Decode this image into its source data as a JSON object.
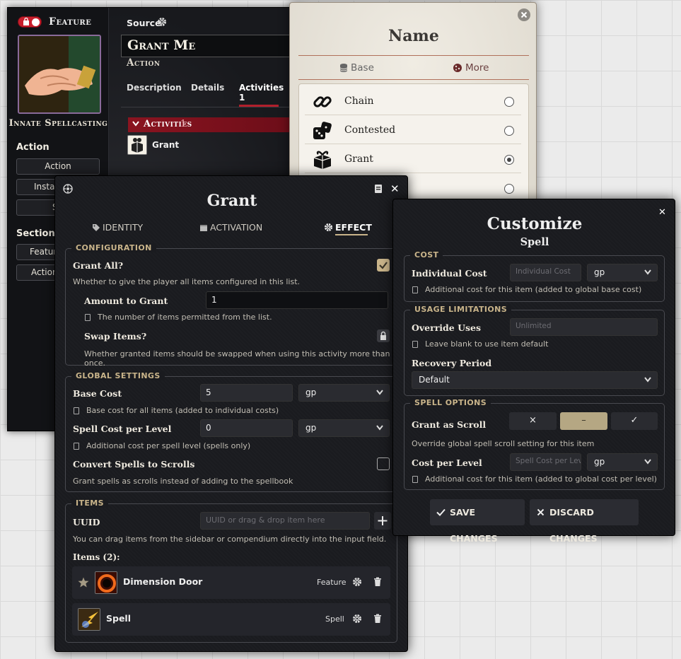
{
  "item_sheet": {
    "type_label": "Feature",
    "portrait_caption": "Innate Spellcasting",
    "activation_heading": "Action",
    "buttons": [
      "Action",
      "Instan",
      "S"
    ],
    "sections_heading": "Sections",
    "section_buttons": [
      "Feature",
      "Actions"
    ],
    "source_label": "Source",
    "item_name": "Grant Me",
    "subtitle": "Action",
    "tabs": [
      "Description",
      "Details",
      "Activities"
    ],
    "activities_tab_count": "1",
    "activities_header": "Activities",
    "activities_header_count": "1",
    "activities": [
      {
        "name": "Grant"
      }
    ]
  },
  "choice_dialog": {
    "title": "Name",
    "tabs": {
      "base": "Base",
      "more": "More"
    },
    "options": [
      {
        "label": "Chain",
        "icon": "chain-link-icon",
        "selected": false
      },
      {
        "label": "Contested",
        "icon": "dice-icon",
        "selected": false
      },
      {
        "label": "Grant",
        "icon": "gift-box-icon",
        "selected": true
      },
      {
        "label": "",
        "icon": "",
        "selected": false
      }
    ]
  },
  "grant_window": {
    "title": "Grant",
    "tabs": {
      "identity": "IDENTITY",
      "activation": "ACTIVATION",
      "effect": "EFFECT"
    },
    "active_tab": "effect",
    "configuration": {
      "legend": "CONFIGURATION",
      "grant_all_label": "Grant All?",
      "grant_all_checked": true,
      "grant_all_hint": "Whether to give the player all items configured in this list.",
      "amount_label": "Amount to Grant",
      "amount_value": "1",
      "amount_hint": "The number of items permitted from the list.",
      "swap_label": "Swap Items?",
      "swap_hint": "Whether granted items should be swapped when using this activity more than once."
    },
    "global": {
      "legend": "GLOBAL SETTINGS",
      "base_cost_label": "Base Cost",
      "base_cost_value": "5",
      "base_cost_unit": "gp",
      "base_cost_hint": "Base cost for all items (added to individual costs)",
      "spell_cost_label": "Spell Cost per Level",
      "spell_cost_value": "0",
      "spell_cost_unit": "gp",
      "spell_cost_hint": "Additional cost per spell level (spells only)",
      "convert_label": "Convert Spells to Scrolls",
      "convert_checked": false,
      "convert_hint": "Grant spells as scrolls instead of adding to the spellbook"
    },
    "items": {
      "legend": "ITEMS",
      "uuid_label": "UUID",
      "uuid_placeholder": "UUID or drag & drop item here",
      "uuid_hint": "You can drag items from the sidebar or compendium directly into the input field.",
      "count_label": "Items (2):",
      "list": [
        {
          "name": "Dimension Door",
          "type": "Feature"
        },
        {
          "name": "Spell",
          "type": "Spell"
        }
      ]
    }
  },
  "customize_window": {
    "title": "Customize",
    "subtitle": "Spell",
    "cost": {
      "legend": "COST",
      "individual_label": "Individual Cost",
      "individual_placeholder": "Individual Cost",
      "unit": "gp",
      "hint": "Additional cost for this item (added to global base cost)"
    },
    "usage": {
      "legend": "USAGE LIMITATIONS",
      "override_label": "Override Uses",
      "override_placeholder": "Unlimited",
      "override_hint": "Leave blank to use item default",
      "recovery_label": "Recovery Period",
      "recovery_value": "Default"
    },
    "spell": {
      "legend": "SPELL OPTIONS",
      "scroll_label": "Grant as Scroll",
      "scroll_options": [
        "×",
        "–",
        "✓"
      ],
      "scroll_selected": 1,
      "scroll_hint": "Override global spell scroll setting for this item",
      "cost_per_level_label": "Cost per Level",
      "cost_per_level_placeholder": "Spell Cost per Lev",
      "cost_per_level_unit": "gp",
      "cost_per_level_hint": "Additional cost for this item (added to global cost per level)"
    },
    "save_label": "SAVE CHANGES",
    "discard_label": "DISCARD CHANGES"
  }
}
